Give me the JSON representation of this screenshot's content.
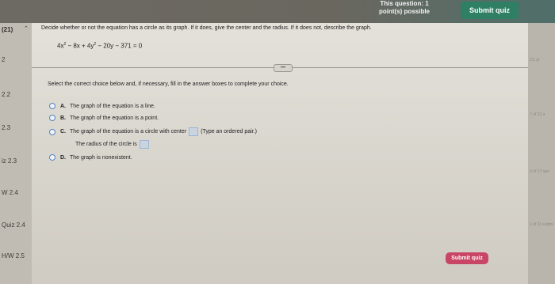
{
  "header": {
    "points_line1": "This question: 1",
    "points_line2": "point(s) possible",
    "submit_label": "Submit quiz"
  },
  "sidebar": {
    "items": [
      {
        "label": "(21)"
      },
      {
        "label": "2"
      },
      {
        "label": "2.2"
      },
      {
        "label": "2.3"
      },
      {
        "label": "iz 2.3"
      },
      {
        "label": "W 2.4"
      },
      {
        "label": "Quiz 2.4"
      },
      {
        "label": "H/W 2.5"
      }
    ]
  },
  "right_strip": {
    "labels": [
      "1/1 pt",
      "7 of 22 a",
      "3 of 17 que",
      "1 of 11 submi"
    ]
  },
  "question": {
    "instruction": "Decide whether or not the equation has a circle as its graph. If it does, give the center and the radius. If it does not, describe the graph.",
    "equation_part1": "4x",
    "equation_part2": " − 8x + 4y",
    "equation_part3": " − 20y − 371 = 0",
    "exponent": "2"
  },
  "answer": {
    "prompt": "Select the correct choice below and, if necessary, fill in the answer boxes to complete your choice.",
    "choices": [
      {
        "letter": "A.",
        "text": "The graph of the equation is a line."
      },
      {
        "letter": "B.",
        "text": "The graph of the equation is a point."
      },
      {
        "letter": "C.",
        "text": "The graph of the equation is a circle with center",
        "suffix": "(Type an ordered pair.)"
      },
      {
        "letter": "D.",
        "text": "The graph is nonexistent."
      }
    ],
    "radius_text": "The radius of the circle is"
  },
  "footer": {
    "submit_label": "Submit quiz"
  },
  "colors": {
    "accent_green": "#2f7f64",
    "submit_pink": "#c94565",
    "radio_blue": "#4f86c6"
  }
}
